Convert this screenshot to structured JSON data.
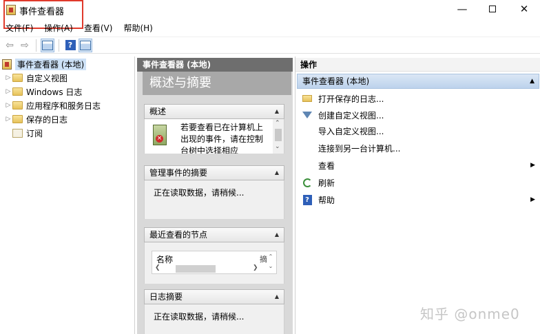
{
  "window": {
    "title": "事件查看器",
    "minimize": "—",
    "close": "✕"
  },
  "menu": [
    "文件(F)",
    "操作(A)",
    "查看(V)",
    "帮助(H)"
  ],
  "toolbar": {
    "back": "⇦",
    "forward": "⇨",
    "help": "?"
  },
  "tree": {
    "root": "事件查看器 (本地)",
    "items": [
      "自定义视图",
      "Windows 日志",
      "应用程序和服务日志",
      "保存的日志",
      "订阅"
    ]
  },
  "middle": {
    "header": "事件查看器 (本地)",
    "title": "概述与摘要",
    "overview": {
      "title": "概述",
      "text": "若要查看已在计算机上出现的事件，请在控制台树中选择相应"
    },
    "admin_summary": {
      "title": "管理事件的摘要",
      "text": "正在读取数据，请稍候..."
    },
    "recent_nodes": {
      "title": "最近查看的节点",
      "col_name": "名称",
      "col_desc": "摘"
    },
    "log_summary": {
      "title": "日志摘要",
      "text": "正在读取数据，请稍候..."
    }
  },
  "actions": {
    "header": "操作",
    "group": "事件查看器 (本地)",
    "items": [
      {
        "label": "打开保存的日志...",
        "icon": "open-folder-icon"
      },
      {
        "label": "创建自定义视图...",
        "icon": "filter-icon"
      },
      {
        "label": "导入自定义视图...",
        "icon": ""
      },
      {
        "label": "连接到另一台计算机...",
        "icon": ""
      },
      {
        "label": "查看",
        "icon": "",
        "submenu": true
      },
      {
        "label": "刷新",
        "icon": "refresh-icon"
      },
      {
        "label": "帮助",
        "icon": "help-icon",
        "submenu": true
      }
    ]
  },
  "watermark": "知乎 @onme0",
  "colors": {
    "highlight_border": "#e0392b",
    "selection": "#cde1f6",
    "pane_header": "#6e6e6e",
    "action_group": "#bcd2ec"
  }
}
